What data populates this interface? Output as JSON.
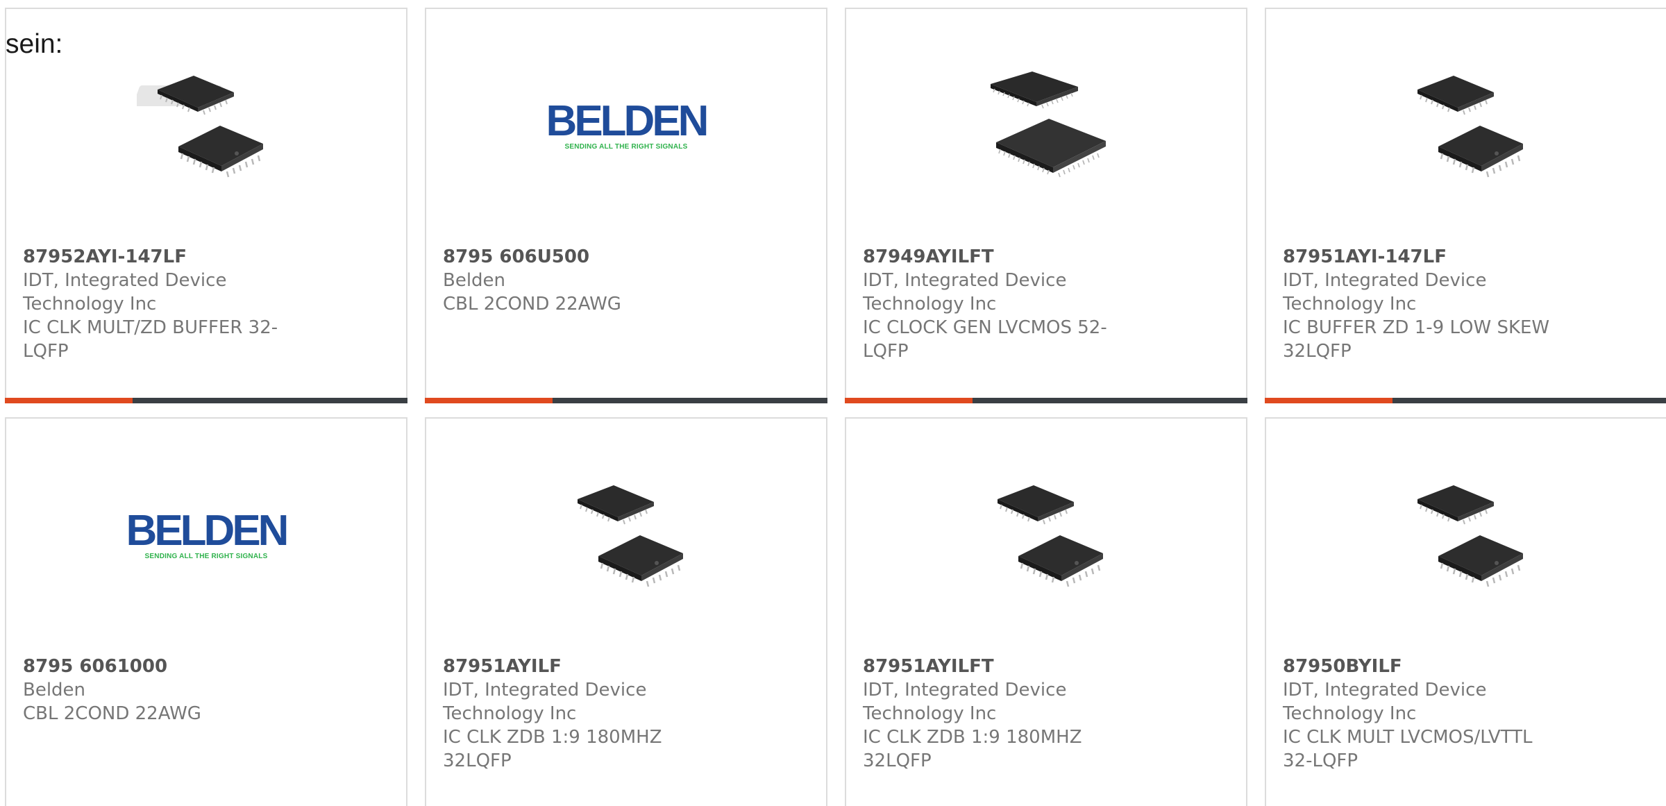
{
  "lead_text": "sein:",
  "logo": {
    "belden_word": "BELDEN",
    "belden_tagline": "SENDING ALL THE RIGHT SIGNALS"
  },
  "colors": {
    "accent": "#e04a1f",
    "bar_dark": "#3a3f44",
    "part_text": "#555555",
    "body_text": "#767676",
    "border": "#dcdcdc"
  },
  "cards": [
    {
      "part": "87952AYI-147LF",
      "manufacturer": "IDT, Integrated Device Technology Inc",
      "description": "IC CLK MULT/ZD BUFFER 32-LQFP",
      "image": "chip-qfp32-icon"
    },
    {
      "part": "8795 606U500",
      "manufacturer": "Belden",
      "description": "CBL 2COND 22AWG",
      "image": "belden-logo"
    },
    {
      "part": "87949AYILFT",
      "manufacturer": "IDT, Integrated Device Technology Inc",
      "description": "IC CLOCK GEN LVCMOS 52-LQFP",
      "image": "chip-qfp52-icon"
    },
    {
      "part": "87951AYI-147LF",
      "manufacturer": "IDT, Integrated Device Technology Inc",
      "description": "IC BUFFER ZD 1-9 LOW SKEW 32LQFP",
      "image": "chip-qfp32-icon"
    },
    {
      "part": "8795 6061000",
      "manufacturer": "Belden",
      "description": "CBL 2COND 22AWG",
      "image": "belden-logo"
    },
    {
      "part": "87951AYILF",
      "manufacturer": "IDT, Integrated Device Technology Inc",
      "description": "IC CLK ZDB 1:9 180MHZ 32LQFP",
      "image": "chip-qfp32-icon"
    },
    {
      "part": "87951AYILFT",
      "manufacturer": "IDT, Integrated Device Technology Inc",
      "description": "IC CLK ZDB 1:9 180MHZ 32LQFP",
      "image": "chip-qfp32-icon"
    },
    {
      "part": "87950BYILF",
      "manufacturer": "IDT, Integrated Device Technology Inc",
      "description": "IC CLK MULT LVCMOS/LVTTL 32-LQFP",
      "image": "chip-qfp32-icon"
    }
  ]
}
